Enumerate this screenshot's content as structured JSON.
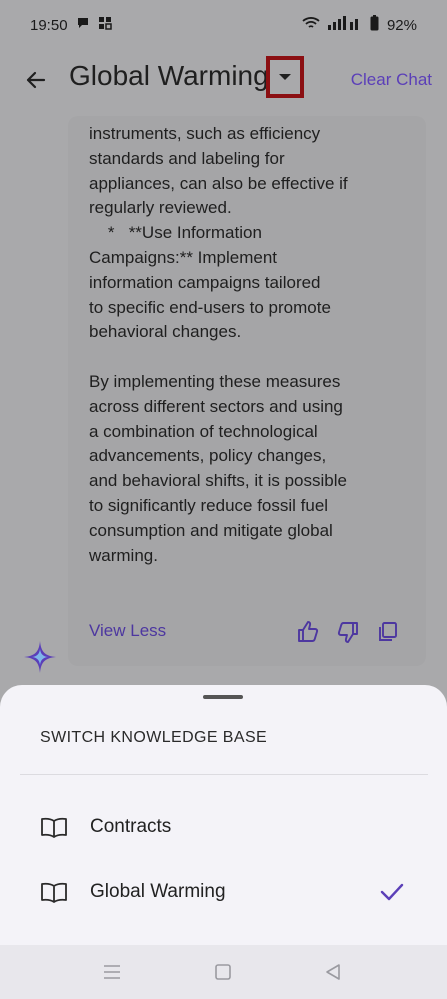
{
  "status": {
    "time": "19:50",
    "battery": "92%"
  },
  "appbar": {
    "title": "Global Warming",
    "clear_label": "Clear Chat"
  },
  "message": {
    "lines": [
      "instruments, such as efficiency",
      "standards and labeling for",
      "appliances, can also be effective if",
      "regularly reviewed.",
      "    *   **Use Information",
      "Campaigns:** Implement",
      "information campaigns tailored",
      "to specific end-users to promote",
      "behavioral changes.",
      "",
      "By implementing these measures",
      "across different sectors and using",
      "a combination of technological",
      "advancements, policy changes,",
      "and behavioral shifts, it is possible",
      "to significantly reduce fossil fuel",
      "consumption and mitigate global",
      "warming."
    ],
    "view_less_label": "View Less"
  },
  "sheet": {
    "title": "SWITCH KNOWLEDGE BASE",
    "items": [
      {
        "label": "Contracts",
        "selected": false
      },
      {
        "label": "Global Warming",
        "selected": true
      }
    ]
  },
  "colors": {
    "accent": "#5b3fb8",
    "highlight_box": "#8b0f12"
  }
}
